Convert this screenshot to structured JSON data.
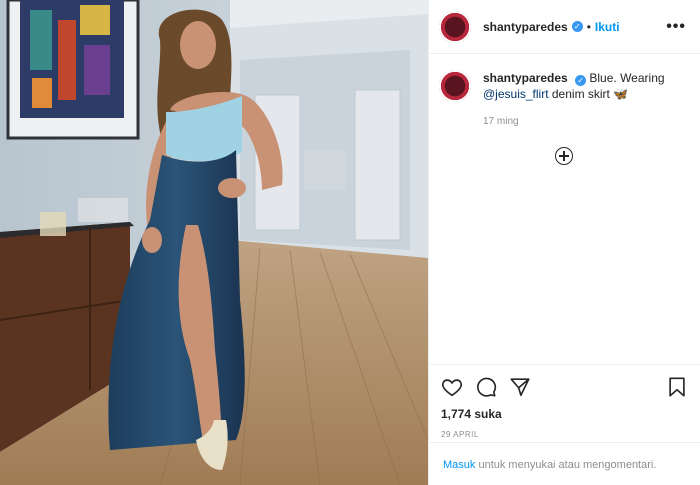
{
  "post": {
    "photo_alt": "",
    "author": "shantyparedes",
    "verified_mark": "✓",
    "separator": "•",
    "follow_label": "Ikuti",
    "more_label": "•••",
    "caption_prefix": "Blue. Wearing",
    "caption_mention": "@jesuis_flirt",
    "caption_suffix": "denim skirt 🦋",
    "comment_time": "17 ming",
    "likes": "1,774 suka",
    "date": "29 APRIL",
    "login_link": "Masuk",
    "login_text": " untuk menyukai atau mengomentari."
  },
  "icons": [
    "heart-icon",
    "comment-icon",
    "share-icon",
    "bookmark-icon",
    "add-comment-icon",
    "more-icon",
    "verified-icon"
  ],
  "colors": {
    "link_blue": "#0095f6",
    "mention_blue": "#00376b",
    "muted": "#8e8e8e",
    "verified": "#3897f0"
  }
}
